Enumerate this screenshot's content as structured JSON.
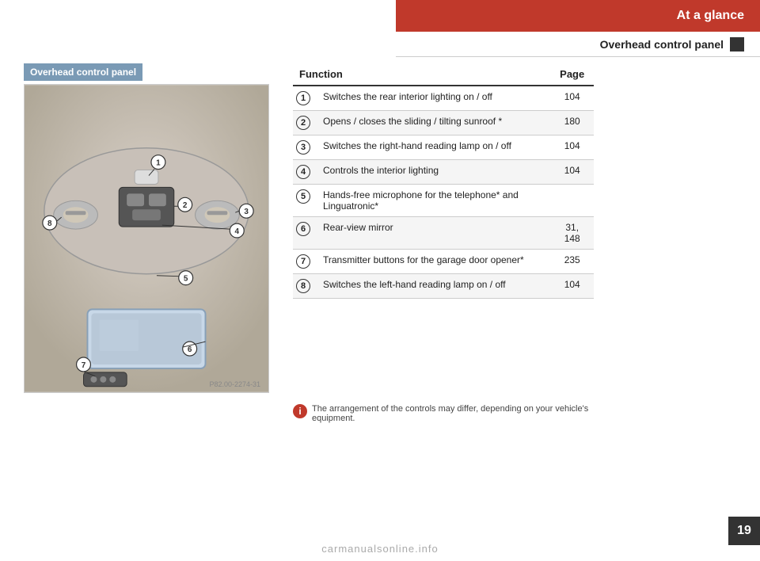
{
  "header": {
    "title": "At a glance",
    "subtitle": "Overhead control panel"
  },
  "image_panel": {
    "label": "Overhead control panel",
    "photo_ref": "P82.00-2274-31"
  },
  "table": {
    "col_function": "Function",
    "col_page": "Page",
    "rows": [
      {
        "num": "1",
        "function": "Switches the rear interior lighting on / off",
        "page": "104"
      },
      {
        "num": "2",
        "function": "Opens / closes the sliding / tilting sunroof *",
        "page": "180"
      },
      {
        "num": "3",
        "function": "Switches the right-hand reading lamp on / off",
        "page": "104"
      },
      {
        "num": "4",
        "function": "Controls the interior lighting",
        "page": "104"
      },
      {
        "num": "5",
        "function": "Hands-free microphone for the telephone* and Linguatronic*",
        "page": ""
      },
      {
        "num": "6",
        "function": "Rear-view mirror",
        "page": "31, 148"
      },
      {
        "num": "7",
        "function": "Transmitter buttons for the garage door opener*",
        "page": "235"
      },
      {
        "num": "8",
        "function": "Switches the left-hand reading lamp on / off",
        "page": "104"
      }
    ]
  },
  "note": {
    "icon": "i",
    "text": "The arrangement of the controls may differ, depending on your vehicle's equipment."
  },
  "page_number": "19",
  "watermark": "carmanualsonline.info"
}
